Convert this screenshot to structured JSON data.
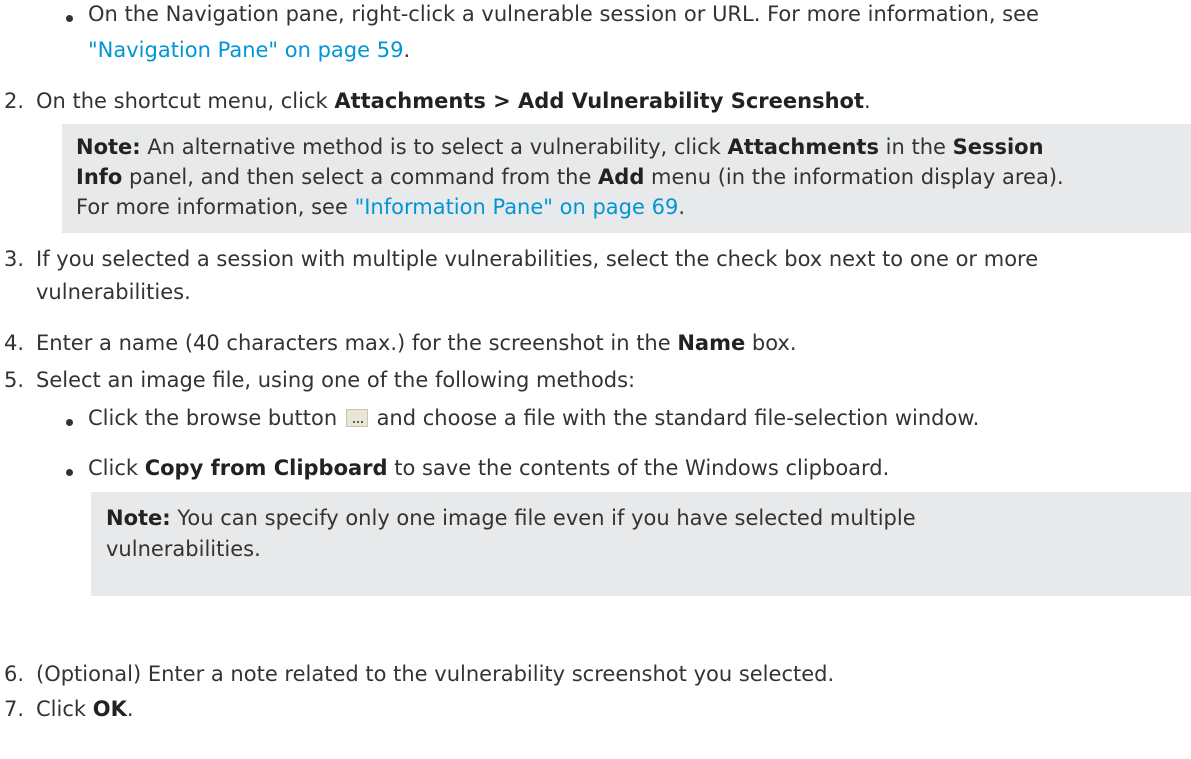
{
  "items": {
    "bullet_nav": {
      "text_a": "On the Navigation pane, right-click a vulnerable session or URL. For more information, see",
      "link": "\"Navigation Pane\" on page 59",
      "text_b": "."
    },
    "step2": {
      "num": "2.",
      "text_a": "On the shortcut menu, click ",
      "bold": "Attachments > Add Vulnerability Screenshot",
      "text_b": "."
    },
    "note1": {
      "label": "Note:",
      "t1": " An alternative method is to select a vulnerability, click ",
      "b1": "Attachments",
      "t2": " in the ",
      "b2": "Session",
      "b3": "Info",
      "t3": " panel, and then select a command from the ",
      "b4": "Add",
      "t4": " menu (in the information display area).",
      "t5": "For more information, see ",
      "link": "\"Information Pane\" on page 69",
      "t6": "."
    },
    "step3": {
      "num": "3.",
      "line1": "If you selected a session with multiple vulnerabilities, select the check box next to one or more",
      "line2": "vulnerabilities."
    },
    "step4": {
      "num": "4.",
      "text_a": "Enter a name (40 characters max.) for the screenshot in the ",
      "bold": "Name",
      "text_b": " box."
    },
    "step5": {
      "num": "5.",
      "text": "Select an image file, using one of the following methods:"
    },
    "sub1": {
      "text_a": "Click the browse button",
      "icon": "browse-button-icon",
      "text_b": "and choose a file with the standard file-selection window."
    },
    "sub2": {
      "text_a": "Click ",
      "bold": "Copy from Clipboard",
      "text_b": " to save the contents of the Windows clipboard."
    },
    "note2": {
      "label": "Note:",
      "line1": " You can specify only one image file even if you have selected multiple",
      "line2": "vulnerabilities."
    },
    "step6": {
      "num": "6.",
      "text": "(Optional) Enter a note related to the vulnerability screenshot you selected."
    },
    "step7": {
      "num": "7.",
      "text_a": "Click ",
      "bold": "OK",
      "text_b": "."
    }
  },
  "colors": {
    "link": "#0096d6",
    "note_bg": "#e7e9ea",
    "text": "#333333"
  }
}
